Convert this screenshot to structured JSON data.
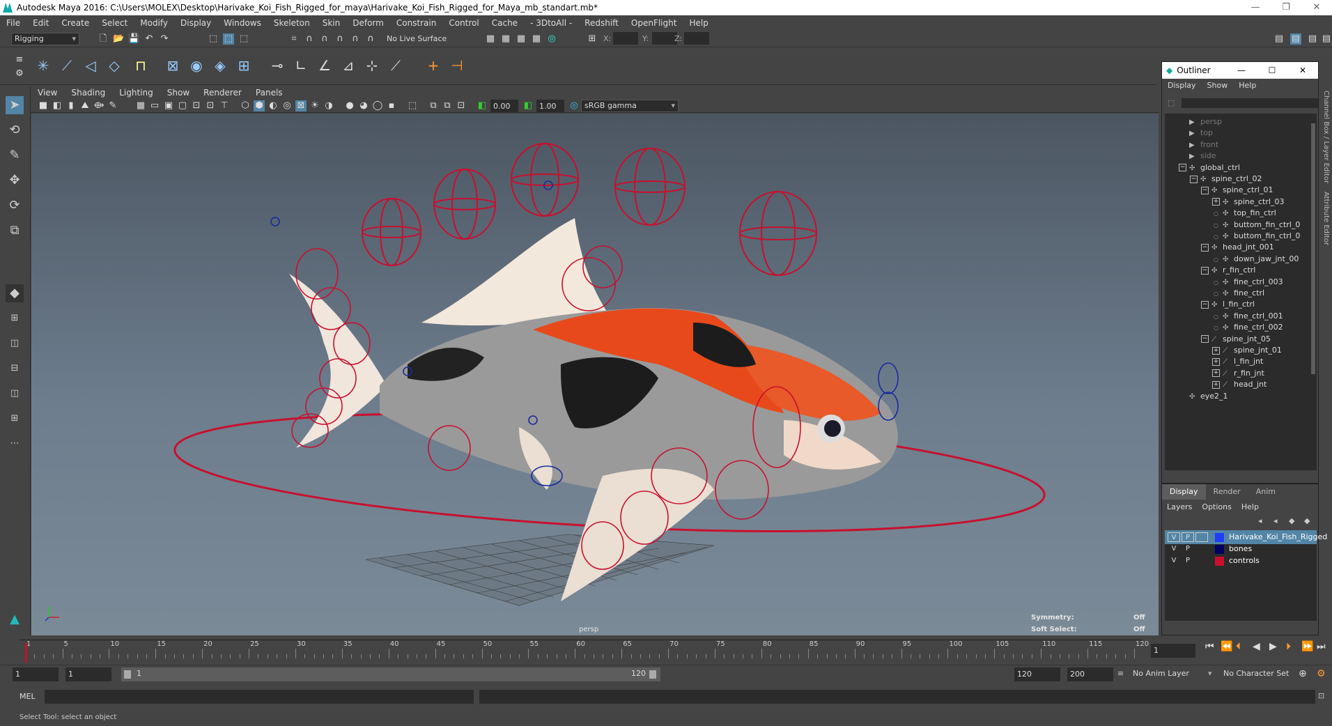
{
  "window": {
    "title": "Autodesk Maya 2016: C:\\Users\\MOLEX\\Desktop\\Harivake_Koi_Fish_Rigged_for_maya\\Harivake_Koi_Fish_Rigged_for_Maya_mb_standart.mb*",
    "minimize": "—",
    "restore": "❐",
    "close": "✕"
  },
  "menubar": [
    "File",
    "Edit",
    "Create",
    "Select",
    "Modify",
    "Display",
    "Windows",
    "Skeleton",
    "Skin",
    "Deform",
    "Constrain",
    "Control",
    "Cache",
    "- 3DtoAll -",
    "Redshift",
    "OpenFlight",
    "Help"
  ],
  "statusline": {
    "mode": "Rigging",
    "live_surface": "No Live Surface",
    "x_label": "X:",
    "y_label": "Y:",
    "z_label": "Z:"
  },
  "panel": {
    "menu": [
      "View",
      "Shading",
      "Lighting",
      "Show",
      "Renderer",
      "Panels"
    ],
    "near": "0.00",
    "far": "1.00",
    "colorspace": "sRGB gamma"
  },
  "viewport": {
    "camera": "persp",
    "symmetry_label": "Symmetry:",
    "symmetry_value": "Off",
    "softselect_label": "Soft Select:",
    "softselect_value": "Off"
  },
  "outliner": {
    "title": "Outliner",
    "menu": [
      "Display",
      "Show",
      "Help"
    ],
    "items": [
      {
        "label": "persp",
        "depth": 0,
        "kind": "cam",
        "dim": true
      },
      {
        "label": "top",
        "depth": 0,
        "kind": "cam",
        "dim": true
      },
      {
        "label": "front",
        "depth": 0,
        "kind": "cam",
        "dim": true
      },
      {
        "label": "side",
        "depth": 0,
        "kind": "cam",
        "dim": true
      },
      {
        "label": "global_ctrl",
        "depth": 0,
        "kind": "ctrl",
        "box": "−"
      },
      {
        "label": "spine_ctrl_02",
        "depth": 1,
        "kind": "ctrl",
        "box": "−"
      },
      {
        "label": "spine_ctrl_01",
        "depth": 2,
        "kind": "ctrl",
        "box": "−"
      },
      {
        "label": "spine_ctrl_03",
        "depth": 3,
        "kind": "ctrl",
        "box": "+"
      },
      {
        "label": "top_fin_ctrl",
        "depth": 3,
        "kind": "ctrl"
      },
      {
        "label": "buttom_fin_ctrl_0",
        "depth": 3,
        "kind": "ctrl"
      },
      {
        "label": "buttom_fin_ctrl_0",
        "depth": 3,
        "kind": "ctrl"
      },
      {
        "label": "head_jnt_001",
        "depth": 2,
        "kind": "ctrl",
        "box": "−"
      },
      {
        "label": "down_jaw_jnt_00",
        "depth": 3,
        "kind": "ctrl"
      },
      {
        "label": "r_fin_ctrl",
        "depth": 2,
        "kind": "ctrl",
        "box": "−"
      },
      {
        "label": "fine_ctrl_003",
        "depth": 3,
        "kind": "ctrl"
      },
      {
        "label": "fine_ctrl",
        "depth": 3,
        "kind": "ctrl"
      },
      {
        "label": "l_fin_ctrl",
        "depth": 2,
        "kind": "ctrl",
        "box": "−"
      },
      {
        "label": "fine_ctrl_001",
        "depth": 3,
        "kind": "ctrl"
      },
      {
        "label": "fine_ctrl_002",
        "depth": 3,
        "kind": "ctrl"
      },
      {
        "label": "spine_jnt_05",
        "depth": 2,
        "kind": "jnt",
        "box": "−"
      },
      {
        "label": "spine_jnt_01",
        "depth": 3,
        "kind": "jnt",
        "box": "+"
      },
      {
        "label": "l_fin_jnt",
        "depth": 3,
        "kind": "jnt",
        "box": "+"
      },
      {
        "label": "r_fin_jnt",
        "depth": 3,
        "kind": "jnt",
        "box": "+"
      },
      {
        "label": "head_jnt",
        "depth": 3,
        "kind": "jnt",
        "box": "+"
      },
      {
        "label": "eye2_1",
        "depth": 0,
        "kind": "ctrl"
      }
    ]
  },
  "sidetabs": [
    "Channel Box / Layer Editor",
    "Attribute Editor"
  ],
  "layers": {
    "tabs": [
      "Display",
      "Render",
      "Anim"
    ],
    "menu": [
      "Layers",
      "Options",
      "Help"
    ],
    "rows": [
      {
        "v": "V",
        "p": "P",
        "color": "#1f3cff",
        "name": "Harivake_Koi_Fish_Rigged",
        "selected": true
      },
      {
        "v": "V",
        "p": "P",
        "color": "#000060",
        "name": "bones",
        "selected": false
      },
      {
        "v": "V",
        "p": "P",
        "color": "#c8102e",
        "name": "controls",
        "selected": false
      }
    ]
  },
  "timeline": {
    "ticks": [
      "1",
      "5",
      "10",
      "15",
      "20",
      "25",
      "30",
      "35",
      "40",
      "45",
      "50",
      "55",
      "60",
      "65",
      "70",
      "75",
      "80",
      "85",
      "90",
      "95",
      "100",
      "105",
      "110",
      "115",
      "120"
    ],
    "current_frame": "1"
  },
  "range": {
    "start": "1",
    "start2": "1",
    "slider_start": "1",
    "slider_end": "120",
    "end": "120",
    "end2": "200",
    "anim_layer": "No Anim Layer",
    "char_set": "No Character Set"
  },
  "cmd": {
    "label": "MEL"
  },
  "help": {
    "text": "Select Tool: select an object"
  },
  "colors": {
    "accent": "#5285a6",
    "control_curve": "#c8102e",
    "joint_curve": "#1a2a9c"
  }
}
